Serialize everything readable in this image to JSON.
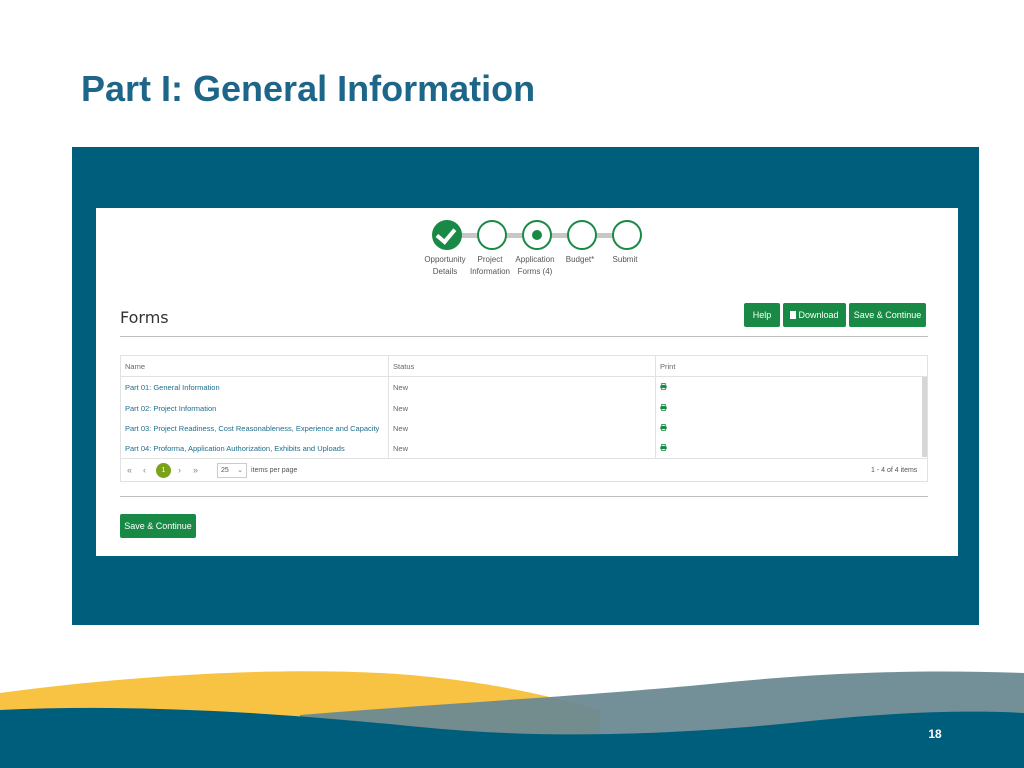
{
  "slide": {
    "title": "Part I: General Information",
    "page_number": "18"
  },
  "stepper": {
    "steps": [
      {
        "line1": "Opportunity",
        "line2": "Details",
        "state": "complete"
      },
      {
        "line1": "Project",
        "line2": "Information",
        "state": "pending"
      },
      {
        "line1": "Application",
        "line2": "Forms (4)",
        "state": "current"
      },
      {
        "line1": "Budget*",
        "line2": "",
        "state": "pending"
      },
      {
        "line1": "Submit",
        "line2": "",
        "state": "pending"
      }
    ]
  },
  "forms": {
    "heading": "Forms",
    "buttons": {
      "help": "Help",
      "download": "Download",
      "save_continue": "Save & Continue"
    },
    "columns": [
      "Name",
      "Status",
      "Print"
    ],
    "rows": [
      {
        "name": "Part 01: General Information",
        "status": "New",
        "print_icon": "printer-icon"
      },
      {
        "name": "Part 02: Project Information",
        "status": "New",
        "print_icon": "printer-icon"
      },
      {
        "name": "Part 03: Project Readiness, Cost Reasonableness, Experience and Capacity",
        "status": "New",
        "print_icon": "printer-icon"
      },
      {
        "name": "Part 04: Proforma, Application Authorization, Exhibits and Uploads",
        "status": "New",
        "print_icon": "printer-icon"
      }
    ],
    "pager": {
      "current_page": "1",
      "page_size": "25",
      "items_per_page_label": "items per page",
      "summary": "1 - 4 of 4 items"
    },
    "bottom_button": "Save & Continue"
  },
  "colors": {
    "title": "#1d6689",
    "panel": "#005e7d",
    "accent_green": "#188a45",
    "pager_active": "#7ba21b",
    "wave_yellow": "#f8c342",
    "wave_gray": "#6b8a94"
  }
}
